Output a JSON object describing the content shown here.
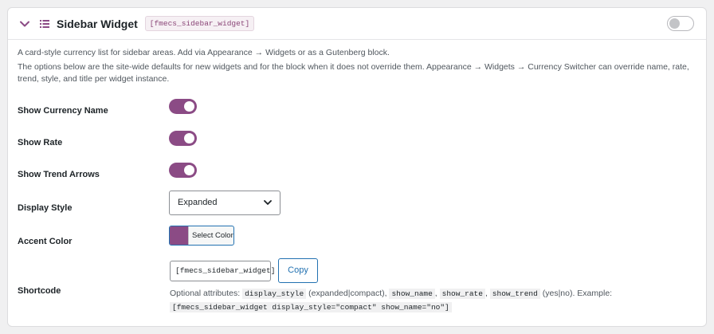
{
  "header": {
    "title": "Sidebar Widget",
    "shortcode_badge": "[fmecs_sidebar_widget]",
    "enabled": false
  },
  "description": {
    "line1": "A card-style currency list for sidebar areas. Add via Appearance → Widgets or as a Gutenberg block.",
    "line2": "The options below are the site-wide defaults for new widgets and for the block when it does not override them. Appearance → Widgets → Currency Switcher can override name, rate, trend, style, and title per widget instance."
  },
  "fields": {
    "show_currency_name": {
      "label": "Show Currency Name",
      "enabled": true
    },
    "show_rate": {
      "label": "Show Rate",
      "enabled": true
    },
    "show_trend_arrows": {
      "label": "Show Trend Arrows",
      "enabled": true
    },
    "display_style": {
      "label": "Display Style",
      "value": "Expanded"
    },
    "accent_color": {
      "label": "Accent Color",
      "value": "#8b4b85",
      "button_label": "Select Color"
    },
    "shortcode": {
      "label": "Shortcode",
      "value": "[fmecs_sidebar_widget]",
      "copy_label": "Copy",
      "help": {
        "prefix": "Optional attributes:",
        "attr_display_style": "display_style",
        "display_style_values": "(expanded|compact),",
        "attr_show_name": "show_name",
        "sep1": ",",
        "attr_show_rate": "show_rate",
        "sep2": ",",
        "attr_show_trend": "show_trend",
        "yes_no": "(yes|no). Example:",
        "example": "[fmecs_sidebar_widget display_style=\"compact\" show_name=\"no\"]"
      }
    }
  },
  "colors": {
    "accent": "#8b4b85",
    "link": "#2271b1"
  }
}
